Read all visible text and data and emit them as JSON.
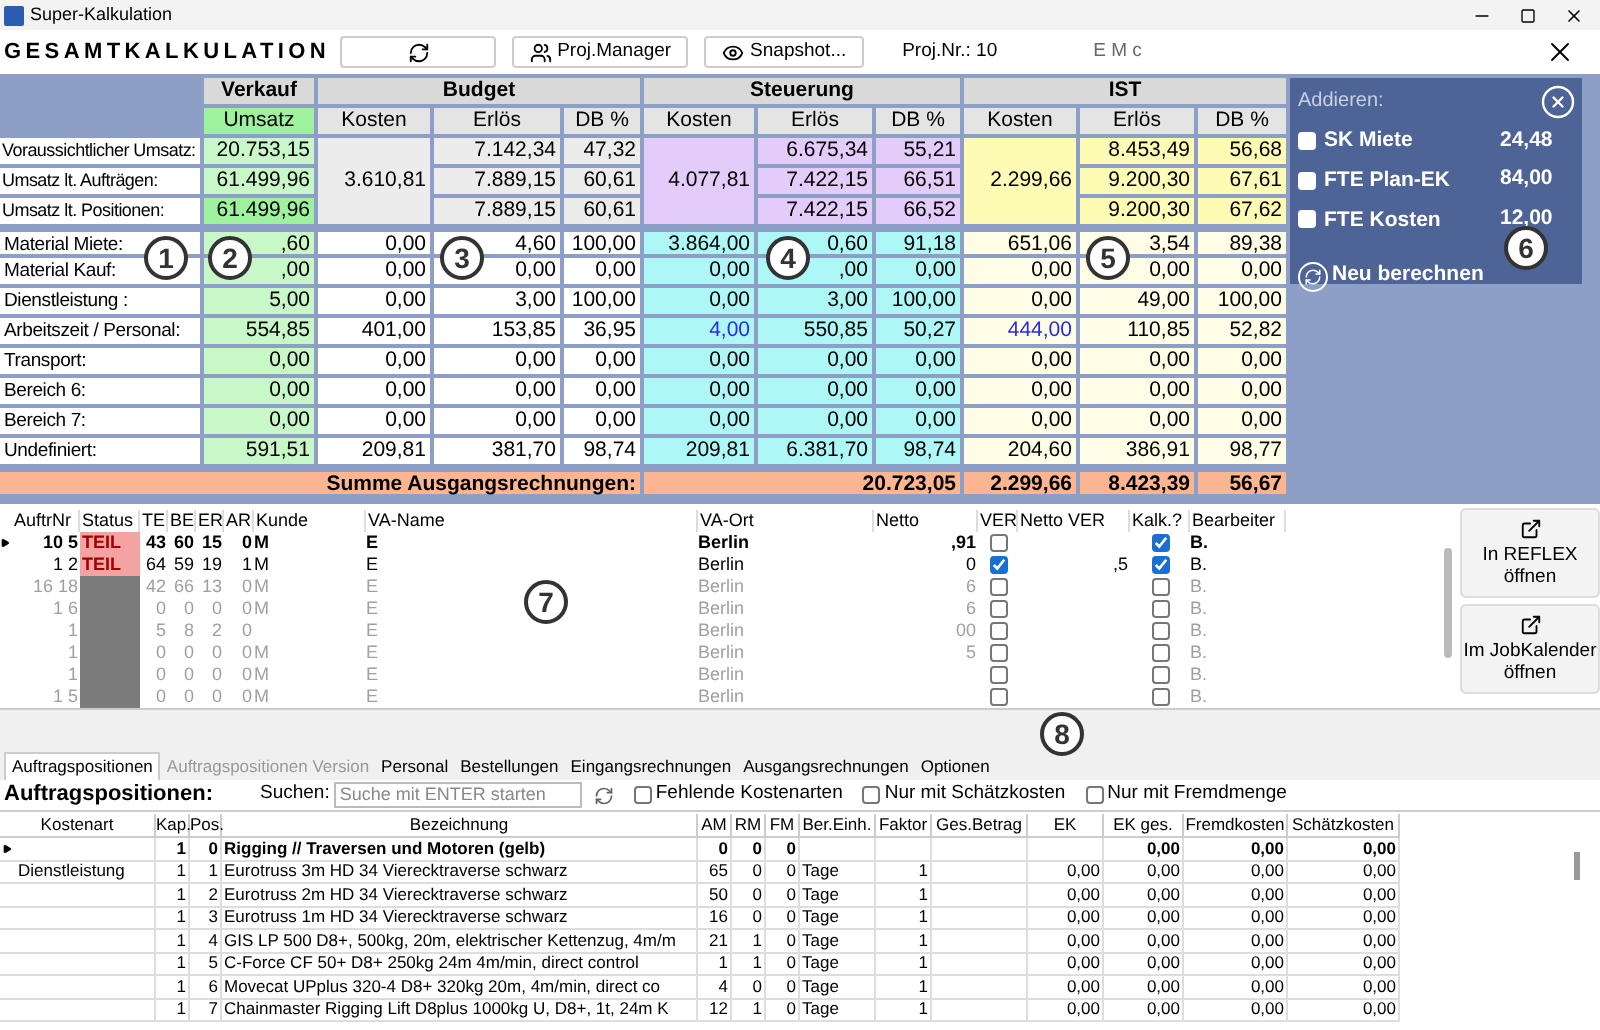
{
  "window": {
    "title": "Super-Kalkulation"
  },
  "header": {
    "title": "GESAMTKALKULATION",
    "buttons": [
      {
        "kind": "refresh"
      },
      {
        "kind": "manager",
        "label": "Proj.Manager"
      },
      {
        "kind": "snapshot",
        "label": "Snapshot..."
      }
    ],
    "project_number": "Proj.Nr.: 10",
    "project_name": "E   M    c"
  },
  "summary": {
    "groups": [
      "Verkauf",
      "Budget",
      "Steuerung",
      "IST"
    ],
    "subheaders": [
      "Umsatz",
      "Kosten",
      "Erlös",
      "DB %",
      "Kosten",
      "Erlös",
      "DB %",
      "Kosten",
      "Erlös",
      "DB %"
    ],
    "merged_costs": [
      "3.610,81",
      "4.077,81",
      "2.299,66"
    ],
    "top_rows": [
      {
        "label": "Voraussichtlicher Umsatz:",
        "values": [
          "20.753,15",
          "7.142,34",
          "47,32",
          "6.675,34",
          "55,21",
          "8.453,49",
          "56,68"
        ],
        "highlight": false
      },
      {
        "label": "Umsatz lt. Aufträgen:",
        "values": [
          "61.499,96",
          "7.889,15",
          "60,61",
          "7.422,15",
          "66,51",
          "9.200,30",
          "67,61"
        ],
        "highlight": false
      },
      {
        "label": "Umsatz lt. Positionen:",
        "values": [
          "61.499,96",
          "7.889,15",
          "60,61",
          "7.422,15",
          "66,52",
          "9.200,30",
          "67,62"
        ],
        "highlight": true
      }
    ],
    "rows": [
      {
        "label": "Material Miete:",
        "values": [
          ",60",
          "0,00",
          "4,60",
          "100,00",
          "3.864,00",
          "0,60",
          "91,18",
          "651,06",
          "3,54",
          "89,38"
        ]
      },
      {
        "label": "Material Kauf:",
        "values": [
          ",00",
          "0,00",
          "0,00",
          "0,00",
          "0,00",
          ",00",
          "0,00",
          "0,00",
          "0,00",
          "0,00"
        ]
      },
      {
        "label": "Dienstleistung :",
        "values": [
          "5,00",
          "0,00",
          "3,00",
          "100,00",
          "0,00",
          "3,00",
          "100,00",
          "0,00",
          "49,00",
          "100,00"
        ]
      },
      {
        "label": "Arbeitszeit / Personal:",
        "values": [
          "554,85",
          "401,00",
          "153,85",
          "36,95",
          {
            "text": "4,00",
            "linked": true
          },
          "550,85",
          "50,27",
          {
            "text": "444,00",
            "linked": true
          },
          "110,85",
          "52,82"
        ]
      },
      {
        "label": "Transport:",
        "values": [
          "0,00",
          "0,00",
          "0,00",
          "0,00",
          "0,00",
          "0,00",
          "0,00",
          "0,00",
          "0,00",
          "0,00"
        ]
      },
      {
        "label": "Bereich 6:",
        "values": [
          "0,00",
          "0,00",
          "0,00",
          "0,00",
          "0,00",
          "0,00",
          "0,00",
          "0,00",
          "0,00",
          "0,00"
        ]
      },
      {
        "label": "Bereich 7:",
        "values": [
          "0,00",
          "0,00",
          "0,00",
          "0,00",
          "0,00",
          "0,00",
          "0,00",
          "0,00",
          "0,00",
          "0,00"
        ]
      },
      {
        "label": "Undefiniert:",
        "values": [
          "591,51",
          "209,81",
          "381,70",
          "98,74",
          "209,81",
          "6.381,70",
          "98,74",
          "204,60",
          "386,91",
          "98,77"
        ]
      }
    ],
    "sum": {
      "label": "Summe Ausgangsrechnungen:",
      "steuerung": "20.723,05",
      "ist": [
        "2.299,66",
        "8.423,39",
        "56,67"
      ]
    }
  },
  "add_panel": {
    "title": "Addieren:",
    "items": [
      {
        "label": "SK Miete",
        "value": "24,48",
        "checked": false
      },
      {
        "label": "FTE Plan-EK",
        "value": "84,00",
        "checked": false
      },
      {
        "label": "FTE Kosten",
        "value": "12,00",
        "checked": false
      }
    ],
    "recalc": "Neu berechnen"
  },
  "orders": {
    "columns": [
      "AuftrNr",
      "Status",
      "TE",
      "BE",
      "ER",
      "AR",
      "Kunde",
      "VA-Name",
      "VA-Ort",
      "Netto",
      "VER",
      "Netto VER",
      "Kalk.?",
      "Bearbeiter"
    ],
    "rows": [
      {
        "nr": "10 5",
        "status": "TEIL",
        "color": "#f4a3a3",
        "te": "43",
        "be": "60",
        "er": "15",
        "ar": "0",
        "kunde": "M",
        "va_name": "E",
        "va_ort": "Berlin",
        "netto": ",91",
        "ver": false,
        "netto_ver": "",
        "kalk": true,
        "bearbeiter": "B.",
        "selected": true,
        "active": true
      },
      {
        "nr": "1 2",
        "status": "TEIL",
        "color": "#f4a3a3",
        "te": "64",
        "be": "59",
        "er": "19",
        "ar": "1",
        "kunde": "M",
        "va_name": "E",
        "va_ort": "Berlin",
        "netto": "0",
        "ver": true,
        "netto_ver": ",5",
        "kalk": true,
        "bearbeiter": "B.",
        "selected": false,
        "active": true
      },
      {
        "nr": "16 18",
        "status": "",
        "color": "#7b7b7b",
        "te": "42",
        "be": "66",
        "er": "13",
        "ar": "0",
        "kunde": "M",
        "va_name": "E",
        "va_ort": "Berlin",
        "netto": "6",
        "ver": false,
        "netto_ver": "",
        "kalk": false,
        "bearbeiter": "B.",
        "selected": false,
        "active": false
      },
      {
        "nr": "1 6",
        "status": "",
        "color": "#7b7b7b",
        "te": "0",
        "be": "0",
        "er": "0",
        "ar": "0",
        "kunde": "M",
        "va_name": "E",
        "va_ort": "Berlin",
        "netto": "6",
        "ver": false,
        "netto_ver": "",
        "kalk": false,
        "bearbeiter": "B.",
        "selected": false,
        "active": false
      },
      {
        "nr": "1",
        "status": "",
        "color": "#7b7b7b",
        "te": "5",
        "be": "8",
        "er": "2",
        "ar": "0",
        "kunde": "",
        "va_name": "E",
        "va_ort": "Berlin",
        "netto": "00",
        "ver": false,
        "netto_ver": "",
        "kalk": false,
        "bearbeiter": "B.",
        "selected": false,
        "active": false
      },
      {
        "nr": "1",
        "status": "",
        "color": "#7b7b7b",
        "te": "0",
        "be": "0",
        "er": "0",
        "ar": "0",
        "kunde": "M",
        "va_name": "E",
        "va_ort": "Berlin",
        "netto": "5",
        "ver": false,
        "netto_ver": "",
        "kalk": false,
        "bearbeiter": "B.",
        "selected": false,
        "active": false
      },
      {
        "nr": "1",
        "status": "",
        "color": "#7b7b7b",
        "te": "0",
        "be": "0",
        "er": "0",
        "ar": "0",
        "kunde": "M",
        "va_name": "E",
        "va_ort": "Berlin",
        "netto": "",
        "ver": false,
        "netto_ver": "",
        "kalk": false,
        "bearbeiter": "B.",
        "selected": false,
        "active": false
      },
      {
        "nr": "1 5",
        "status": "",
        "color": "#7b7b7b",
        "te": "0",
        "be": "0",
        "er": "0",
        "ar": "0",
        "kunde": "M",
        "va_name": "E",
        "va_ort": "Berlin",
        "netto": "",
        "ver": false,
        "netto_ver": "",
        "kalk": false,
        "bearbeiter": "B.",
        "selected": false,
        "active": false
      }
    ]
  },
  "side_buttons": [
    "In REFLEX öffnen",
    "Im JobKalender öffnen"
  ],
  "tabs": [
    {
      "label": "Auftragspositionen",
      "selected": true,
      "disabled": false
    },
    {
      "label": "Auftragspositionen Version",
      "selected": false,
      "disabled": true
    },
    {
      "label": "Personal",
      "selected": false,
      "disabled": false
    },
    {
      "label": "Bestellungen",
      "selected": false,
      "disabled": false
    },
    {
      "label": "Eingangsrechnungen",
      "selected": false,
      "disabled": false
    },
    {
      "label": "Ausgangsrechnungen",
      "selected": false,
      "disabled": false
    },
    {
      "label": "Optionen",
      "selected": false,
      "disabled": false
    }
  ],
  "positions": {
    "title": "Auftragspositionen:",
    "search_label": "Suchen:",
    "search": {
      "placeholder": "Suche mit ENTER starten"
    },
    "filters": [
      {
        "label": "Fehlende Kostenarten",
        "checked": false
      },
      {
        "label": "Nur mit Schätzkosten",
        "checked": false
      },
      {
        "label": "Nur mit Fremdmenge",
        "checked": false
      }
    ],
    "columns": [
      "Kostenart",
      "Kap.",
      "Pos.",
      "Bezeichnung",
      "AM",
      "RM",
      "FM",
      "Ber.Einh.",
      "Faktor",
      "Ges.Betrag",
      "EK",
      "EK ges.",
      "Fremdkosten",
      "Schätzkosten"
    ],
    "rows": [
      {
        "cells": [
          "",
          "1",
          "0",
          "Rigging // Traversen und Motoren (gelb)",
          "0",
          "0",
          "0",
          "",
          "",
          "",
          "",
          "0,00",
          "0,00",
          "0,00"
        ],
        "selected": true,
        "kind": "group"
      },
      {
        "cells": [
          "Dienstleistung",
          "1",
          "1",
          "Eurotruss 3m HD 34 Vierecktraverse schwarz",
          "65",
          "0",
          "0",
          "Tage",
          "1",
          "",
          "0,00",
          "0,00",
          "0,00",
          "0,00"
        ],
        "selected": false,
        "kind": "item"
      },
      {
        "cells": [
          "",
          "1",
          "2",
          "Eurotruss 2m HD 34 Vierecktraverse schwarz",
          "50",
          "0",
          "0",
          "Tage",
          "1",
          "",
          "0,00",
          "0,00",
          "0,00",
          "0,00"
        ],
        "selected": false,
        "kind": "item"
      },
      {
        "cells": [
          "",
          "1",
          "3",
          "Eurotruss 1m HD 34 Vierecktraverse schwarz",
          "16",
          "0",
          "0",
          "Tage",
          "1",
          "",
          "0,00",
          "0,00",
          "0,00",
          "0,00"
        ],
        "selected": false,
        "kind": "item"
      },
      {
        "cells": [
          "",
          "1",
          "4",
          "GIS LP 500 D8+, 500kg, 20m, elektrischer Kettenzug, 4m/m",
          "21",
          "1",
          "0",
          "Tage",
          "1",
          "",
          "0,00",
          "0,00",
          "0,00",
          "0,00"
        ],
        "selected": false,
        "kind": "item"
      },
      {
        "cells": [
          "",
          "1",
          "5",
          "C-Force CF 50+ D8+ 250kg 24m 4m/min, direct control",
          "1",
          "1",
          "0",
          "Tage",
          "1",
          "",
          "0,00",
          "0,00",
          "0,00",
          "0,00"
        ],
        "selected": false,
        "kind": "item"
      },
      {
        "cells": [
          "",
          "1",
          "6",
          "Movecat UPplus 320-4 D8+ 320kg 20m, 4m/min, direct co",
          "4",
          "0",
          "0",
          "Tage",
          "1",
          "",
          "0,00",
          "0,00",
          "0,00",
          "0,00"
        ],
        "selected": false,
        "kind": "item"
      },
      {
        "cells": [
          "",
          "1",
          "7",
          "Chainmaster Rigging Lift D8plus 1000kg U, D8+, 1t, 24m K",
          "12",
          "1",
          "0",
          "Tage",
          "1",
          "",
          "0,00",
          "0,00",
          "0,00",
          "0,00"
        ],
        "selected": false,
        "kind": "item"
      }
    ]
  },
  "callouts": [
    "1",
    "2",
    "3",
    "4",
    "5",
    "6",
    "7",
    "8"
  ]
}
